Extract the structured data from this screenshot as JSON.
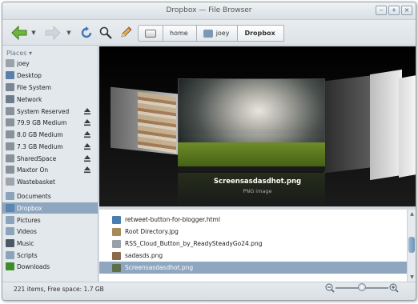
{
  "window": {
    "title": "Dropbox — File Browser"
  },
  "title_buttons": {
    "minimize": "‒",
    "maximize": "+",
    "close": "×"
  },
  "breadcrumb": [
    "home",
    "joey",
    "Dropbox"
  ],
  "sidebar": {
    "header": "Places",
    "items": [
      {
        "label": "joey",
        "icon": "home-icon",
        "color": "#9aa3ac"
      },
      {
        "label": "Desktop",
        "icon": "desktop-icon",
        "color": "#5a7fa8"
      },
      {
        "label": "File System",
        "icon": "filesystem-icon",
        "color": "#7b8793"
      },
      {
        "label": "Network",
        "icon": "network-icon",
        "color": "#6d7b8b"
      },
      {
        "label": "System Reserved",
        "icon": "drive-icon",
        "color": "#8a9199"
      },
      {
        "label": "79.9 GB Medium",
        "icon": "drive-icon",
        "color": "#8a9199"
      },
      {
        "label": "8.0 GB Medium",
        "icon": "drive-icon",
        "color": "#8a9199"
      },
      {
        "label": "7.3 GB Medium",
        "icon": "drive-icon",
        "color": "#8a9199"
      },
      {
        "label": "SharedSpace",
        "icon": "drive-icon",
        "color": "#8a9199"
      },
      {
        "label": "Maxtor   On",
        "icon": "drive-icon",
        "color": "#8a9199"
      },
      {
        "label": "Wastebasket",
        "icon": "trash-icon",
        "color": "#9ea5ab"
      },
      {
        "label": "Documents",
        "icon": "folder-icon",
        "color": "#8ba3bb"
      },
      {
        "label": "Dropbox",
        "icon": "folder-icon",
        "color": "#5b86b2"
      },
      {
        "label": "Pictures",
        "icon": "folder-icon",
        "color": "#8ba3bb"
      },
      {
        "label": "Videos",
        "icon": "folder-icon",
        "color": "#8ba3bb"
      },
      {
        "label": "Music",
        "icon": "music-icon",
        "color": "#4b5966"
      },
      {
        "label": "Scripts",
        "icon": "folder-icon",
        "color": "#8ba3bb"
      },
      {
        "label": "Downloads",
        "icon": "download-icon",
        "color": "#3f8c2a"
      }
    ],
    "selected": "Dropbox"
  },
  "preview": {
    "name": "Screensasdasdhot.png",
    "type": "PNG image"
  },
  "files": [
    {
      "name": "retweet-button-for-blogger.html",
      "icon": "html-file-icon",
      "color": "#4a7db0"
    },
    {
      "name": "Root Directory.jpg",
      "icon": "image-file-icon",
      "color": "#a58a5a"
    },
    {
      "name": "RSS_Cloud_Button_by_ReadySteadyGo24.png",
      "icon": "image-file-icon",
      "color": "#9aa0a8"
    },
    {
      "name": "sadasds.png",
      "icon": "image-file-icon",
      "color": "#8b6a4a"
    },
    {
      "name": "Screensasdasdhot.png",
      "icon": "image-file-icon",
      "color": "#5c6f4a"
    }
  ],
  "selected_file": "Screensasdasdhot.png",
  "status": {
    "text": "221 items, Free space: 1.7 GB"
  },
  "zoom": {
    "level": 0.5
  }
}
